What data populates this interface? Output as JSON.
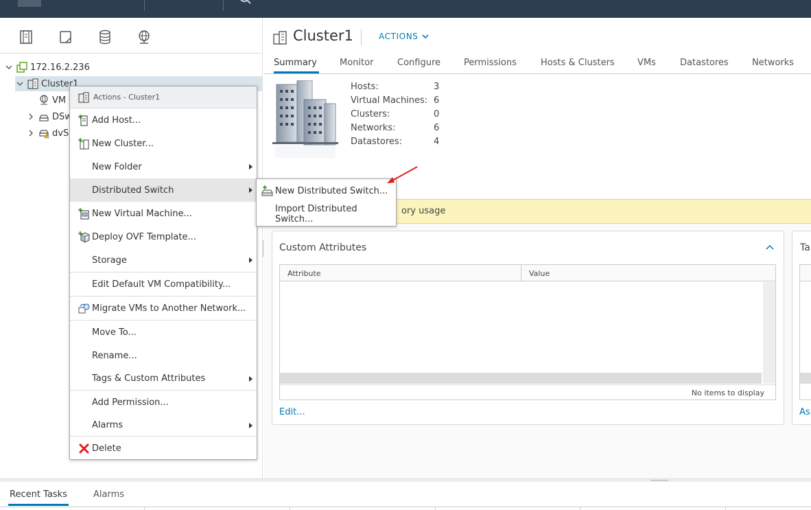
{
  "tree": {
    "vcenter": "172.16.2.236",
    "cluster": "Cluster1",
    "children": [
      "VM",
      "DSw",
      "dvS"
    ]
  },
  "context_menu": {
    "header": "Actions - Cluster1",
    "items": [
      {
        "label": "Add Host..."
      },
      {
        "label": "New Cluster..."
      },
      {
        "label": "New Folder"
      },
      {
        "label": "Distributed Switch"
      },
      {
        "label": "New Virtual Machine..."
      },
      {
        "label": "Deploy OVF Template..."
      },
      {
        "label": "Storage"
      },
      {
        "label": "Edit Default VM Compatibility..."
      },
      {
        "label": "Migrate VMs to Another Network..."
      },
      {
        "label": "Move To..."
      },
      {
        "label": "Rename..."
      },
      {
        "label": "Tags & Custom Attributes"
      },
      {
        "label": "Add Permission..."
      },
      {
        "label": "Alarms"
      },
      {
        "label": "Delete"
      }
    ]
  },
  "submenu": {
    "items": [
      {
        "label": "New Distributed Switch..."
      },
      {
        "label": "Import Distributed Switch..."
      }
    ]
  },
  "header": {
    "title": "Cluster1",
    "actions_label": "ACTIONS",
    "tabs": [
      "Summary",
      "Monitor",
      "Configure",
      "Permissions",
      "Hosts & Clusters",
      "VMs",
      "Datastores",
      "Networks"
    ]
  },
  "summary": {
    "stats": [
      {
        "label": "Hosts:",
        "value": "3"
      },
      {
        "label": "Virtual Machines:",
        "value": "6"
      },
      {
        "label": "Clusters:",
        "value": "0"
      },
      {
        "label": "Networks:",
        "value": "6"
      },
      {
        "label": "Datastores:",
        "value": "4"
      }
    ]
  },
  "warning": {
    "text": "ory usage"
  },
  "custom_attributes": {
    "title": "Custom Attributes",
    "columns": [
      "Attribute",
      "Value"
    ],
    "empty_text": "No items to display",
    "edit_label": "Edit..."
  },
  "tags_card": {
    "title": "Ta",
    "assign_label": "As"
  },
  "bottom_panel": {
    "tabs": [
      "Recent Tasks",
      "Alarms"
    ]
  },
  "colors": {
    "accent": "#0079b8",
    "topbar": "#2d3e50",
    "warning_bg": "#fcf3bd",
    "delete_red": "#e02020"
  }
}
